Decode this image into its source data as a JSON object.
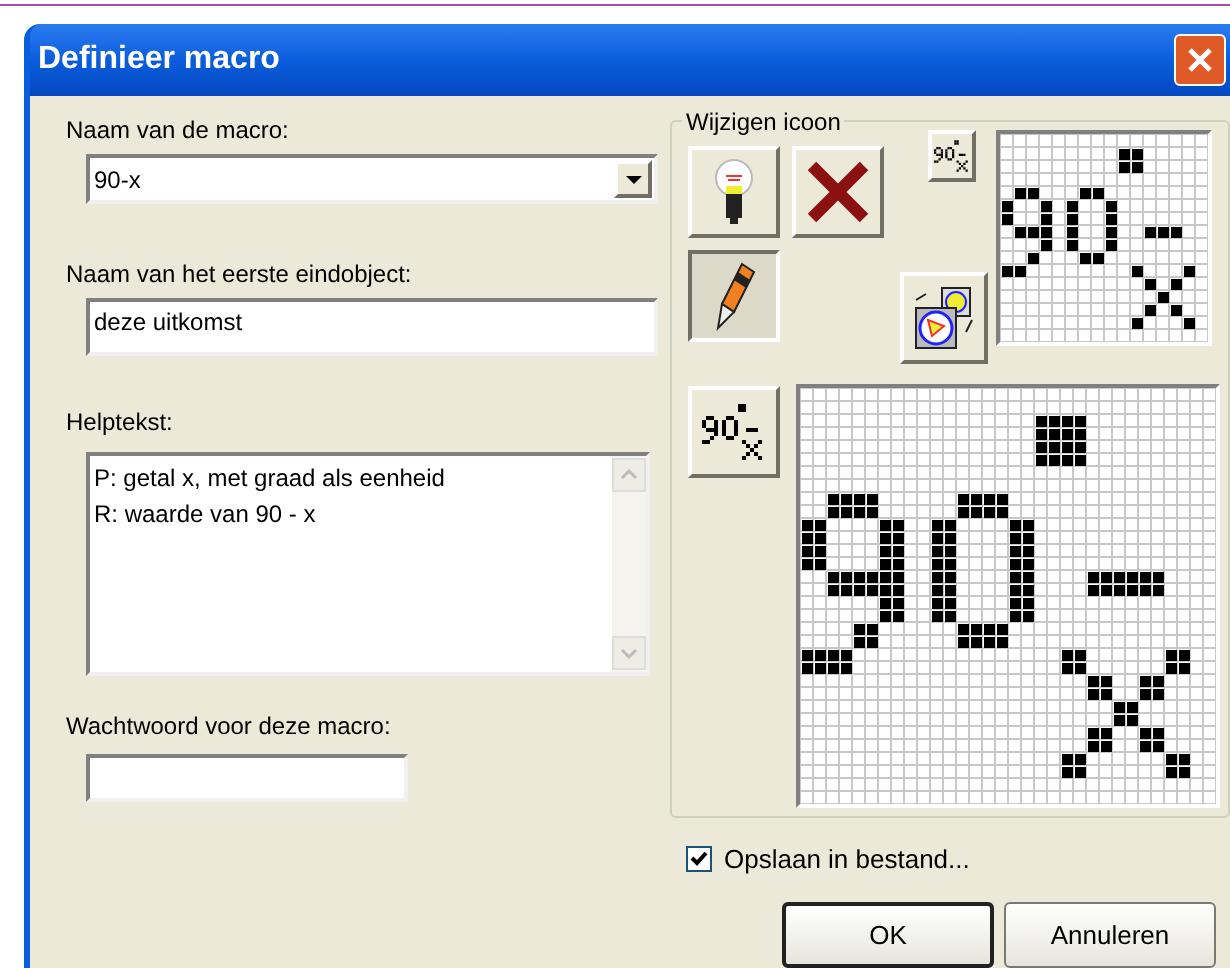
{
  "window": {
    "title": "Definieer macro"
  },
  "macro_name": {
    "label": "Naam van de macro:",
    "value": "90-x"
  },
  "first_object": {
    "label": "Naam van het eerste eindobject:",
    "value": "deze uitkomst"
  },
  "help_text": {
    "label": "Helptekst:",
    "lines": [
      "P: getal x, met graad als eenheid",
      "R: waarde van 90 - x"
    ]
  },
  "password": {
    "label": "Wachtwoord voor deze macro:"
  },
  "icon_editor": {
    "title": "Wijzigen icoon",
    "tools": [
      {
        "kind": "bulb",
        "selected": false
      },
      {
        "kind": "delete",
        "selected": false
      },
      {
        "kind": "pencil",
        "selected": true
      }
    ]
  },
  "save_to_file": {
    "label": "Opslaan in bestand...",
    "checked": true
  },
  "buttons": [
    {
      "label": "OK",
      "default": true
    },
    {
      "label": "Annuleren",
      "default": false
    }
  ]
}
